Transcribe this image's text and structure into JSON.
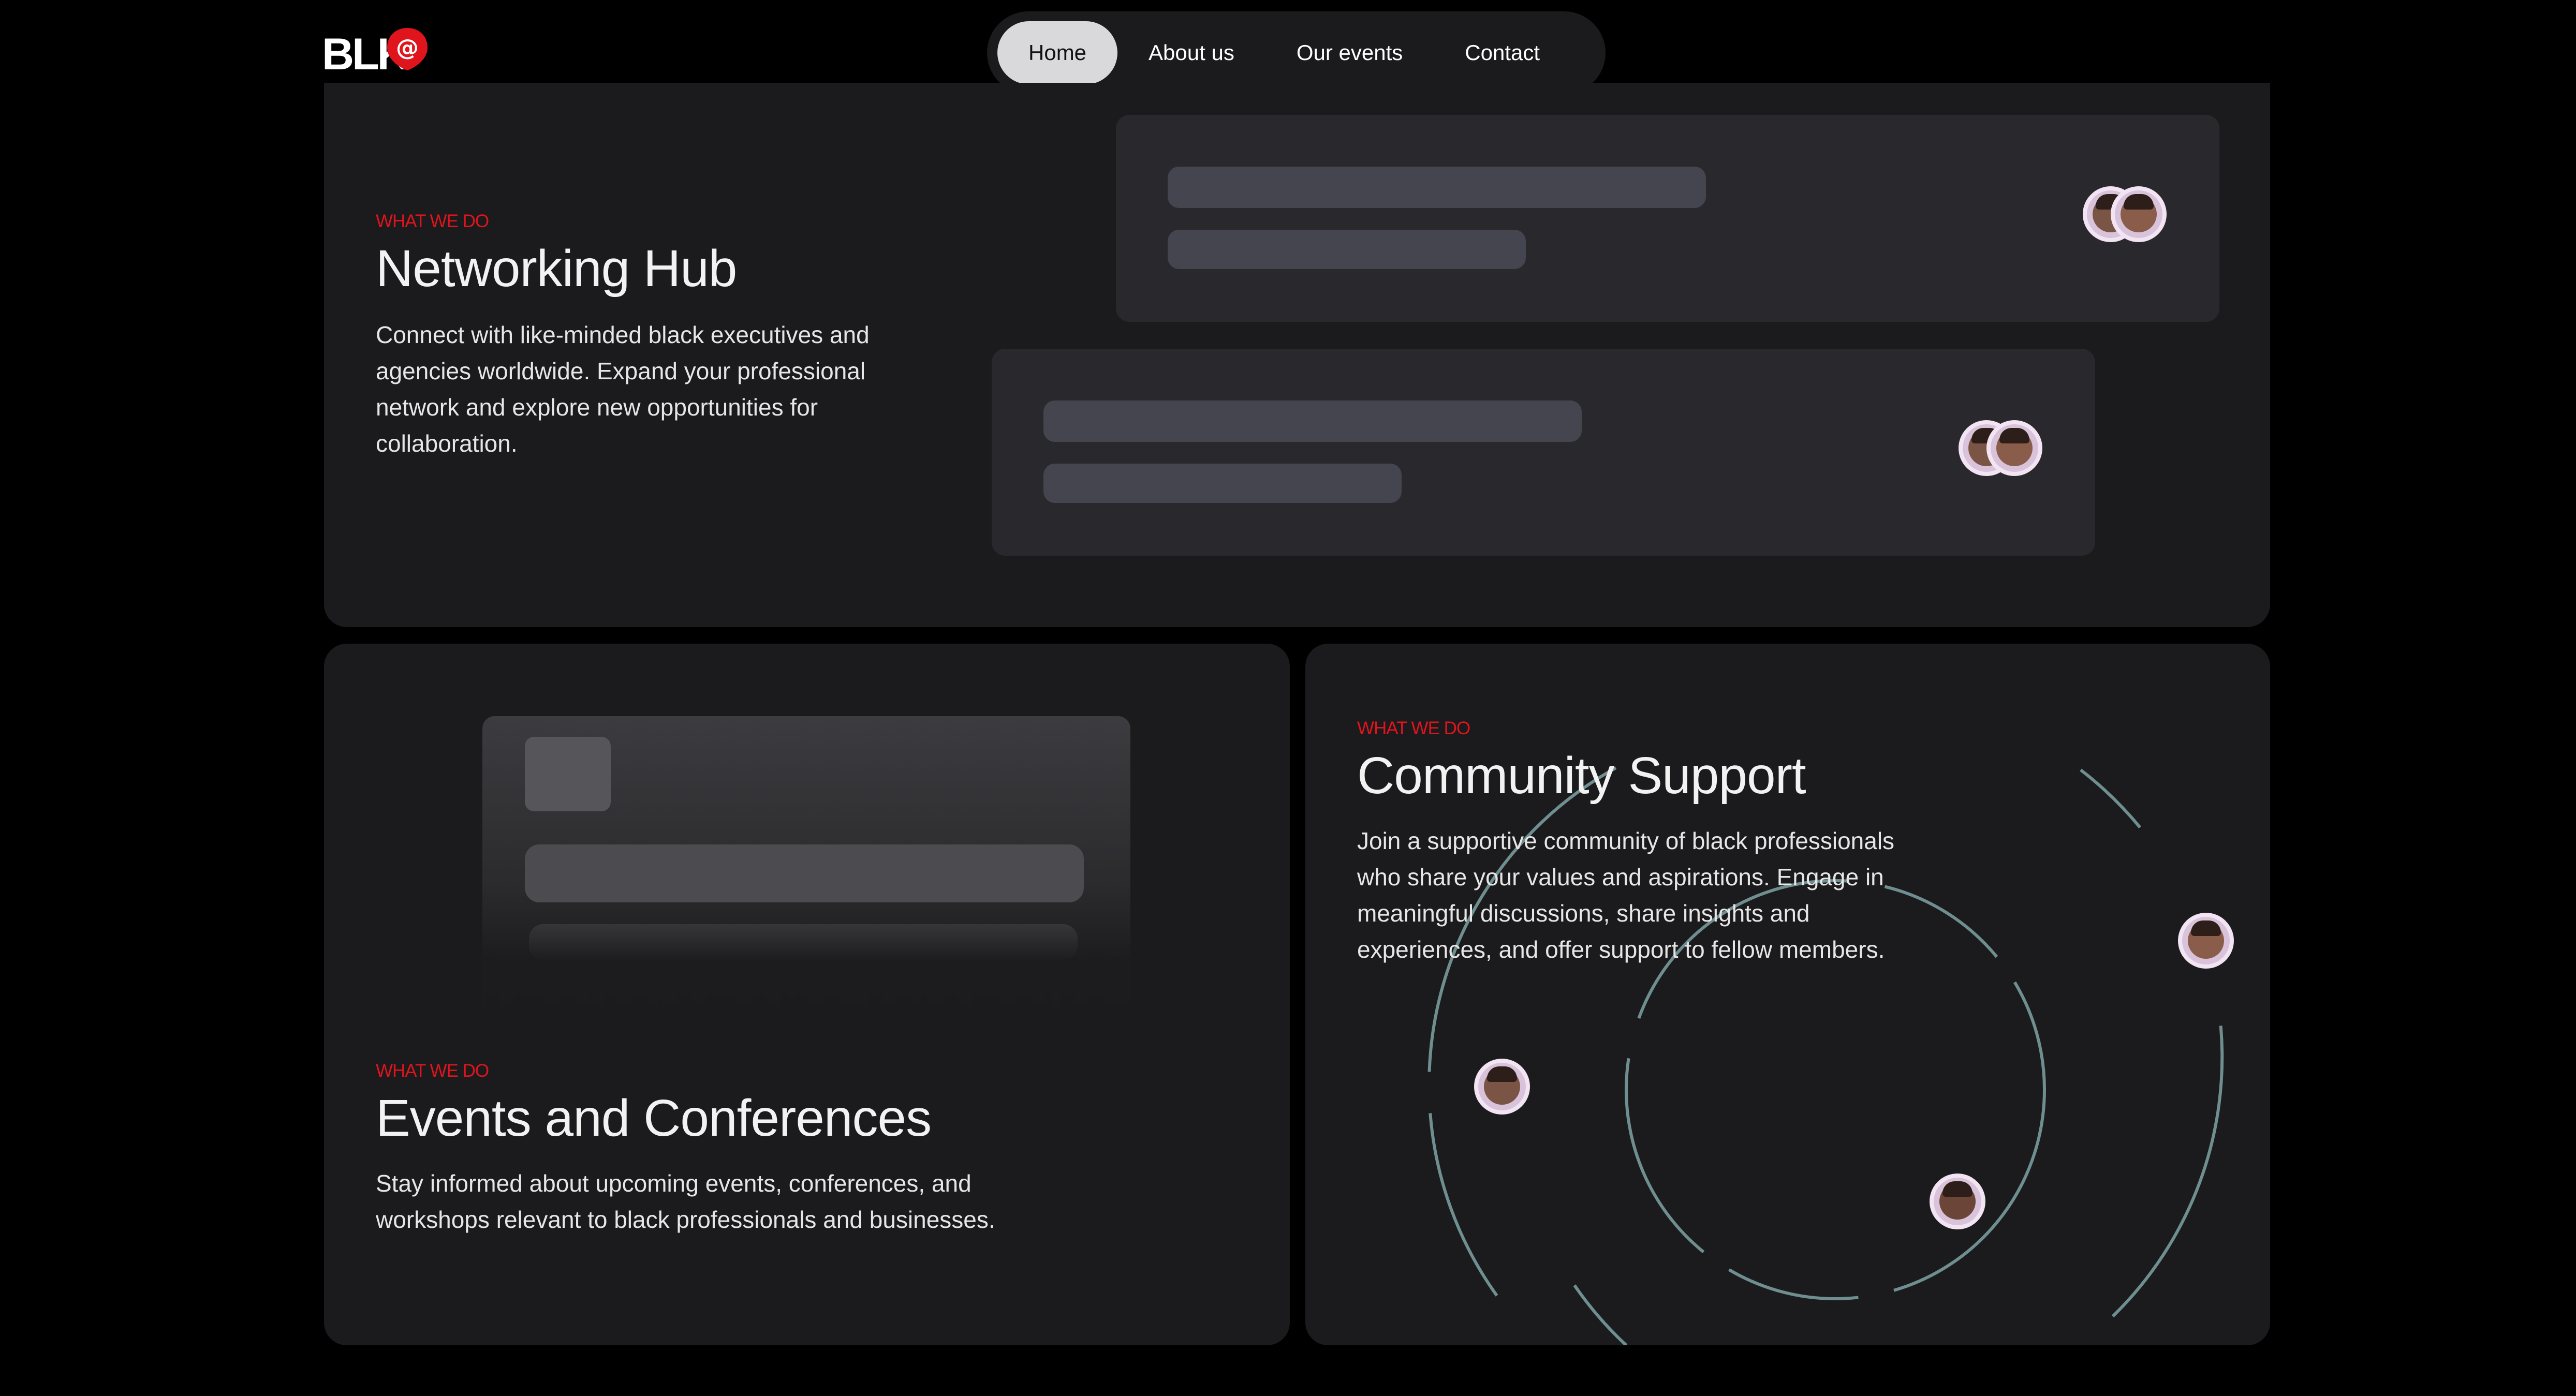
{
  "brand": {
    "logo_text": "BLK",
    "logo_symbol": "@",
    "accent": "#e0141c"
  },
  "nav": {
    "items": [
      {
        "label": "Home",
        "active": true
      },
      {
        "label": "About us",
        "active": false
      },
      {
        "label": "Our events",
        "active": false
      },
      {
        "label": "Contact",
        "active": false
      }
    ]
  },
  "networking": {
    "eyebrow": "WHAT WE DO",
    "title": "Networking Hub",
    "description": "Connect with like-minded black executives and agencies worldwide. Expand your professional network and explore new opportunities for collaboration."
  },
  "events": {
    "eyebrow": "WHAT WE DO",
    "title": "Events and Conferences",
    "description": "Stay informed about upcoming events, conferences, and workshops relevant to black professionals and businesses."
  },
  "community": {
    "eyebrow": "WHAT WE DO",
    "title": "Community Support",
    "description": "Join a supportive community of black professionals who share your values and aspirations. Engage in meaningful discussions, share insights and experiences, and offer support to fellow members."
  },
  "colors": {
    "background": "#000000",
    "card": "#1b1b1d",
    "panel": "#28282d",
    "placeholder_bar": "#45454f",
    "orbit_stroke": "#6f8e90",
    "eyebrow": "#e0141c"
  }
}
